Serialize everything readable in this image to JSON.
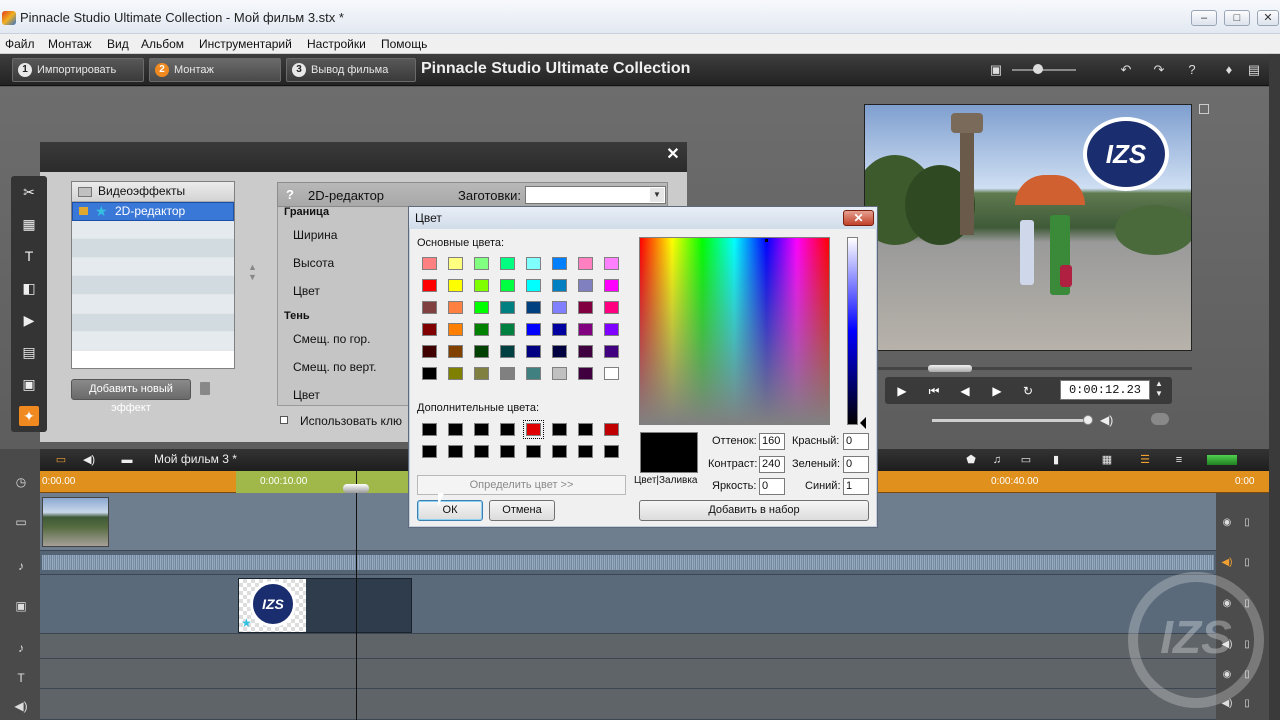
{
  "window": {
    "title": "Pinnacle Studio Ultimate Collection - Мой фильм 3.stx *"
  },
  "menu": [
    "Файл",
    "Монтаж",
    "Вид",
    "Альбом",
    "Инструментарий",
    "Настройки",
    "Помощь"
  ],
  "toolbar": {
    "steps": [
      {
        "num": "1",
        "label": "Импортировать"
      },
      {
        "num": "2",
        "label": "Монтаж"
      },
      {
        "num": "3",
        "label": "Вывод фильма"
      }
    ],
    "app_title": "Pinnacle Studio Ultimate Collection"
  },
  "effects_panel": {
    "list_header": "Видеоэффекты",
    "selected_item": "2D-редактор",
    "add_button": "Добавить новый эффект",
    "editor_name": "2D-редактор",
    "presets_label": "Заготовки:",
    "section_border": "Граница",
    "width_label": "Ширина",
    "height_label": "Высота",
    "color_label": "Цвет",
    "section_shadow": "Тень",
    "shift_h_label": "Смещ. по гор.",
    "shift_v_label": "Смещ. по верт.",
    "color2_label": "Цвет",
    "use_key_label": "Использовать клю"
  },
  "color_dialog": {
    "title": "Цвет",
    "basic_colors_label": "Основные цвета:",
    "custom_colors_label": "Дополнительные цвета:",
    "define_button": "Определить цвет >>",
    "ok_button": "ОК",
    "cancel_button": "Отмена",
    "add_to_set_button": "Добавить в набор",
    "preview_label": "Цвет|Заливка",
    "hue_label": "Оттенок:",
    "hue_value": "160",
    "contrast_label": "Контраст:",
    "contrast_value": "240",
    "brightness_label": "Яркость:",
    "brightness_value": "0",
    "red_label": "Красный:",
    "red_value": "0",
    "green_label": "Зеленый:",
    "green_value": "0",
    "blue_label": "Синий:",
    "blue_value": "1",
    "basic_colors": [
      "#ff8080",
      "#ffff80",
      "#80ff80",
      "#00ff80",
      "#80ffff",
      "#0080ff",
      "#ff80c0",
      "#ff80ff",
      "#ff0000",
      "#ffff00",
      "#80ff00",
      "#00ff40",
      "#00ffff",
      "#0080c0",
      "#8080c0",
      "#ff00ff",
      "#804040",
      "#ff8040",
      "#00ff00",
      "#008080",
      "#004080",
      "#8080ff",
      "#800040",
      "#ff0080",
      "#800000",
      "#ff8000",
      "#008000",
      "#008040",
      "#0000ff",
      "#0000a0",
      "#800080",
      "#8000ff",
      "#400000",
      "#804000",
      "#004000",
      "#004040",
      "#000080",
      "#000040",
      "#400040",
      "#400080",
      "#000000",
      "#808000",
      "#808040",
      "#808080",
      "#408080",
      "#c0c0c0",
      "#400040",
      "#ffffff"
    ],
    "custom_colors": [
      "#000000",
      "#000000",
      "#000000",
      "#000000",
      "#e00000",
      "#000000",
      "#000000",
      "#c00000",
      "#000000",
      "#000000",
      "#000000",
      "#000000",
      "#000000",
      "#000000",
      "#000000",
      "#000000"
    ],
    "selected_custom_index": 4
  },
  "preview": {
    "timecode": "0:00:12.23",
    "logo_text": "IZS"
  },
  "timeline": {
    "project_name": "Мой фильм 3 *",
    "ticks": [
      "0:00.00",
      "0:00:10.00",
      "0:00:40.00",
      "0:00"
    ],
    "title_logo_text": "IZS"
  }
}
